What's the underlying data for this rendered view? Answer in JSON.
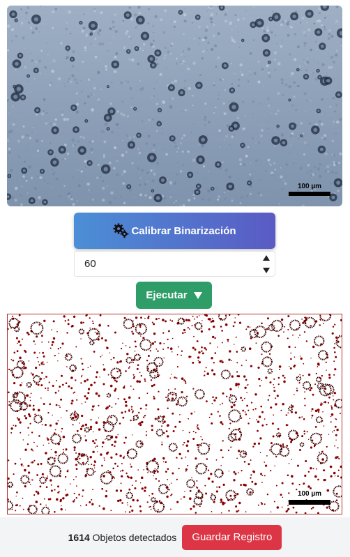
{
  "micrograph": {
    "scale_label": "100 µm"
  },
  "calibrate_button": {
    "label": "Calibrar Binarización",
    "icon": "gears-icon"
  },
  "threshold_input": {
    "value": "60"
  },
  "run_button": {
    "label": "Ejecutar",
    "icon": "caret-down-icon"
  },
  "binary_image": {
    "scale_label": "100 µm",
    "dot_color": "#8b0000"
  },
  "footer": {
    "object_count": "1614",
    "count_label": "Objetos detectados",
    "save_label": "Guardar Registro"
  },
  "colors": {
    "calibrate_start": "#4b8fd6",
    "calibrate_end": "#5a5bc4",
    "run": "#2e9d67",
    "save": "#dc3545"
  }
}
